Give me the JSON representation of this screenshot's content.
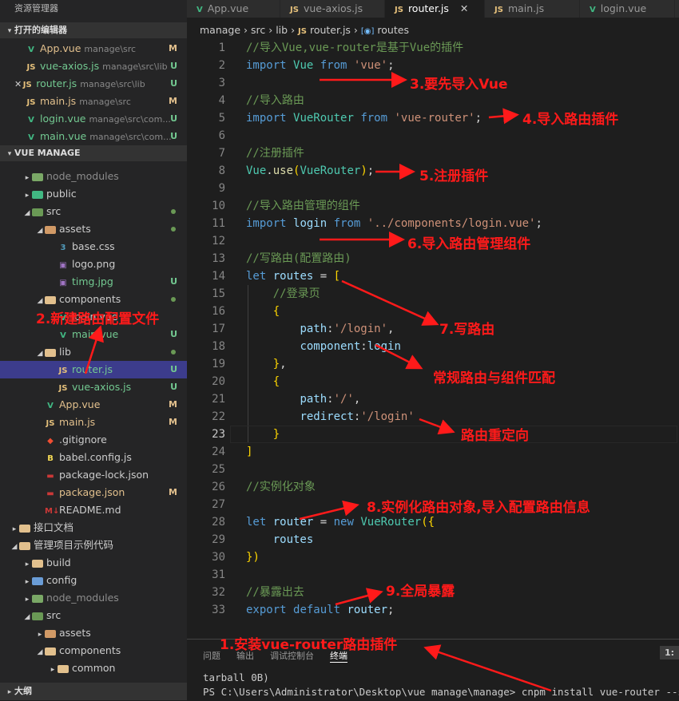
{
  "sidebar": {
    "title": "资源管理器",
    "open_editors_label": "打开的编辑器",
    "open_editors": [
      {
        "icon": "V",
        "name": "App.vue",
        "path": "manage\\src",
        "status": "M",
        "dirty": false
      },
      {
        "icon": "JS",
        "name": "vue-axios.js",
        "path": "manage\\src\\lib",
        "status": "U",
        "dirty": false
      },
      {
        "icon": "JS",
        "name": "router.js",
        "path": "manage\\src\\lib",
        "status": "U",
        "dirty": true
      },
      {
        "icon": "JS",
        "name": "main.js",
        "path": "manage\\src",
        "status": "M",
        "dirty": false
      },
      {
        "icon": "V",
        "name": "login.vue",
        "path": "manage\\src\\com...",
        "status": "U",
        "dirty": false
      },
      {
        "icon": "V",
        "name": "main.vue",
        "path": "manage\\src\\com...",
        "status": "U",
        "dirty": false
      }
    ],
    "project_label": "VUE MANAGE",
    "tree": [
      {
        "name": "node_modules",
        "status": ""
      },
      {
        "name": "public",
        "status": ""
      },
      {
        "name": "src",
        "status": "●"
      },
      {
        "name": "assets",
        "status": "●"
      },
      {
        "name": "base.css",
        "status": ""
      },
      {
        "name": "logo.png",
        "status": ""
      },
      {
        "name": "timg.jpg",
        "status": "U"
      },
      {
        "name": "components",
        "status": "●"
      },
      {
        "name": "login.vue",
        "status": ""
      },
      {
        "name": "main.vue",
        "status": "U"
      },
      {
        "name": "lib",
        "status": "●"
      },
      {
        "name": "router.js",
        "status": "U"
      },
      {
        "name": "vue-axios.js",
        "status": "U"
      },
      {
        "name": "App.vue",
        "status": "M"
      },
      {
        "name": "main.js",
        "status": "M"
      },
      {
        "name": ".gitignore",
        "status": ""
      },
      {
        "name": "babel.config.js",
        "status": ""
      },
      {
        "name": "package-lock.json",
        "status": ""
      },
      {
        "name": "package.json",
        "status": "M"
      },
      {
        "name": "README.md",
        "status": ""
      },
      {
        "name": "接口文档",
        "status": ""
      },
      {
        "name": "管理项目示例代码",
        "status": ""
      },
      {
        "name": "build",
        "status": ""
      },
      {
        "name": "config",
        "status": ""
      },
      {
        "name": "node_modules",
        "status": ""
      },
      {
        "name": "src",
        "status": ""
      },
      {
        "name": "assets",
        "status": ""
      },
      {
        "name": "components",
        "status": ""
      },
      {
        "name": "common",
        "status": ""
      }
    ],
    "outline_label": "大纲"
  },
  "tabs": [
    {
      "icon": "V",
      "label": "App.vue",
      "active": false
    },
    {
      "icon": "JS",
      "label": "vue-axios.js",
      "active": false
    },
    {
      "icon": "JS",
      "label": "router.js",
      "active": true
    },
    {
      "icon": "JS",
      "label": "main.js",
      "active": false
    },
    {
      "icon": "V",
      "label": "login.vue",
      "active": false
    }
  ],
  "breadcrumb": {
    "p1": "manage",
    "p2": "src",
    "p3": "lib",
    "p4": "router.js",
    "p5": "routes"
  },
  "code": [
    "//导入Vue,vue-router是基于Vue的插件",
    "import Vue from 'vue';",
    "",
    "//导入路由",
    "import VueRouter from 'vue-router';",
    "",
    "//注册插件",
    "Vue.use(VueRouter);",
    "",
    "//导入路由管理的组件",
    "import login from '../components/login.vue';",
    "",
    "//写路由(配置路由)",
    "let routes = [",
    "    //登录页",
    "    {",
    "        path:'/login',",
    "        component:login",
    "    },",
    "    {",
    "        path:'/',",
    "        redirect:'/login'",
    "    }",
    "]",
    "",
    "//实例化对象",
    "",
    "let router = new VueRouter({",
    "    routes",
    "})",
    "",
    "//暴露出去",
    "export default router;"
  ],
  "current_line": 23,
  "panel": {
    "tabs": [
      "问题",
      "输出",
      "调试控制台",
      "终端"
    ],
    "active_tab": "终端",
    "terminal_line1": "tarball 0B)",
    "terminal_line2": "PS C:\\Users\\Administrator\\Desktop\\vue manage\\manage> cnpm install vue-router --save",
    "terminal_selector": "1: "
  },
  "annotations": {
    "a1": "1.安装vue-router路由插件",
    "a2": "2.新建路由配置文件",
    "a3": "3.要先导入Vue",
    "a4": "4.导入路由插件",
    "a5": "5.注册插件",
    "a6": "6.导入路由管理组件",
    "a7": "7.写路由",
    "a8": "常规路由与组件匹配",
    "a9": "路由重定向",
    "a10": "8.实例化路由对象,导入配置路由信息",
    "a11": "9.全局暴露"
  },
  "colors": {
    "annotation": "#ff1a1a",
    "selection": "#3c3c8c",
    "keyword": "#569cd6",
    "string": "#ce9178",
    "comment": "#6a9955"
  }
}
